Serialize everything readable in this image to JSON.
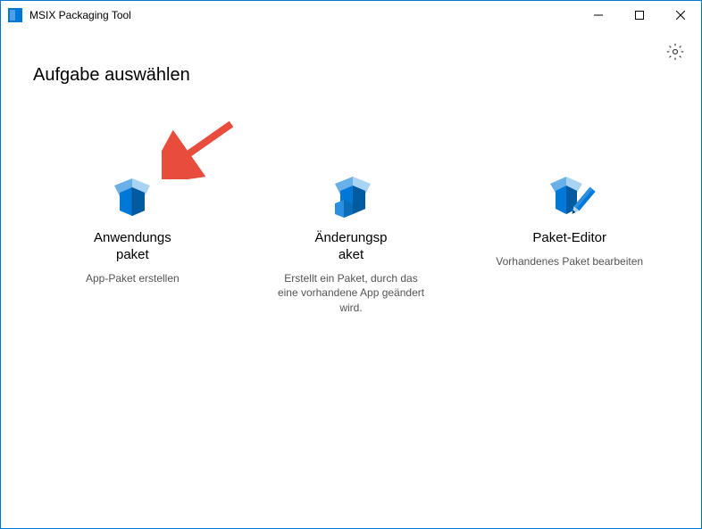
{
  "titlebar": {
    "title": "MSIX Packaging Tool"
  },
  "page": {
    "heading": "Aufgabe auswählen"
  },
  "options": [
    {
      "icon": "box-open-icon",
      "title": "Anwendungs\npaket",
      "description": "App-Paket erstellen"
    },
    {
      "icon": "box-with-sub-box-icon",
      "title": "Änderungsp\naket",
      "description": "Erstellt ein Paket, durch das eine vorhandene App geändert wird."
    },
    {
      "icon": "box-with-pencil-icon",
      "title": "Paket-Editor",
      "description": "Vorhandenes Paket bearbeiten"
    }
  ],
  "settings_icon": "gear-icon"
}
